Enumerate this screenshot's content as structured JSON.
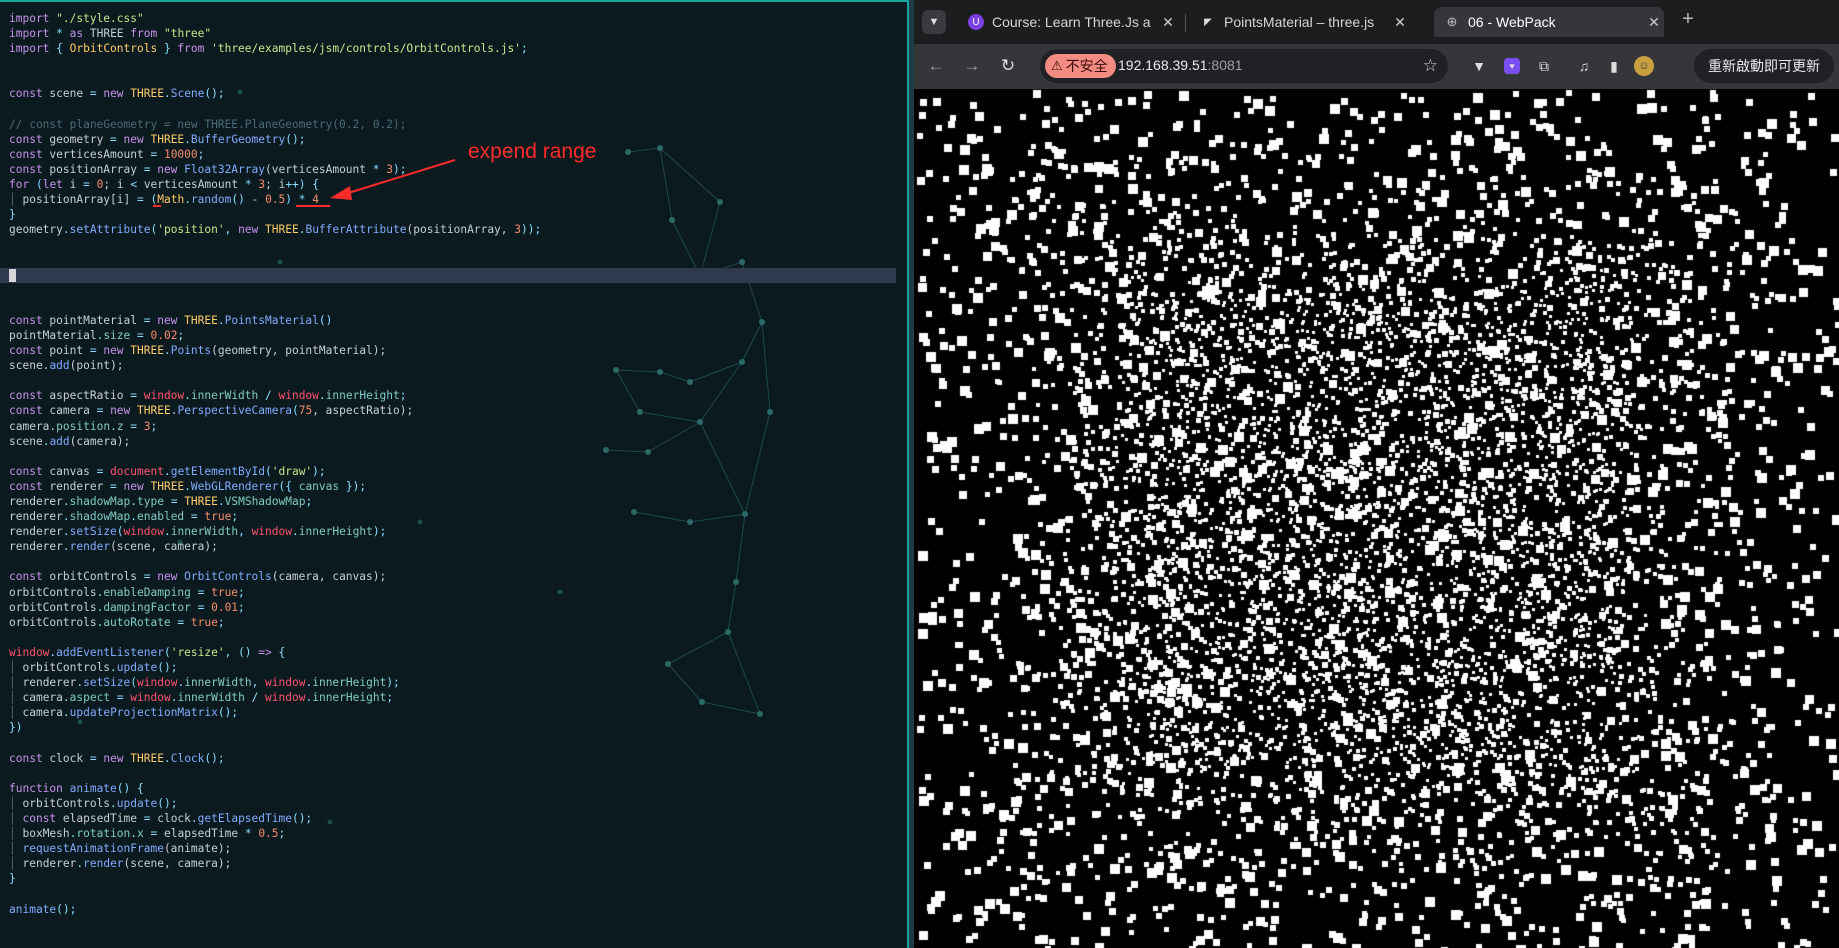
{
  "editor": {
    "annotation": "expend range",
    "lines": [
      [
        [
          "import ",
          "k"
        ],
        [
          "\"./style.css\"",
          "s"
        ]
      ],
      [
        [
          "import ",
          "k"
        ],
        [
          "* ",
          "p"
        ],
        [
          "as ",
          "k"
        ],
        [
          "THREE ",
          ""
        ],
        [
          "from ",
          "k"
        ],
        [
          "\"three\"",
          "s"
        ]
      ],
      [
        [
          "import ",
          "k"
        ],
        [
          "{ ",
          "p"
        ],
        [
          "OrbitControls",
          "t"
        ],
        [
          " } ",
          "p"
        ],
        [
          "from ",
          "k"
        ],
        [
          "'three/examples/jsm/controls/OrbitControls.js'",
          "s"
        ],
        [
          ";",
          "p"
        ]
      ],
      [],
      [],
      [
        [
          "const ",
          "k"
        ],
        [
          "scene ",
          ""
        ],
        [
          "= ",
          "p"
        ],
        [
          "new ",
          "k"
        ],
        [
          "THREE",
          "t"
        ],
        [
          ".",
          "p"
        ],
        [
          "Scene",
          "f"
        ],
        [
          "();",
          "p"
        ]
      ],
      [],
      [
        [
          "// const planeGeometry = new THREE.PlaneGeometry(0.2, 0.2);",
          "c"
        ]
      ],
      [
        [
          "const ",
          "k"
        ],
        [
          "geometry ",
          ""
        ],
        [
          "= ",
          "p"
        ],
        [
          "new ",
          "k"
        ],
        [
          "THREE",
          "t"
        ],
        [
          ".",
          "p"
        ],
        [
          "BufferGeometry",
          "f"
        ],
        [
          "();",
          "p"
        ]
      ],
      [
        [
          "const ",
          "k"
        ],
        [
          "verticesAmount ",
          ""
        ],
        [
          "= ",
          "p"
        ],
        [
          "10000",
          "n"
        ],
        [
          ";",
          "p"
        ]
      ],
      [
        [
          "const ",
          "k"
        ],
        [
          "positionArray ",
          ""
        ],
        [
          "= ",
          "p"
        ],
        [
          "new ",
          "k"
        ],
        [
          "Float32Array",
          "f"
        ],
        [
          "(verticesAmount ",
          ""
        ],
        [
          "* ",
          "p"
        ],
        [
          "3",
          "n"
        ],
        [
          ");",
          "p"
        ]
      ],
      [
        [
          "for ",
          "k"
        ],
        [
          "(",
          "p"
        ],
        [
          "let ",
          "k"
        ],
        [
          "i ",
          ""
        ],
        [
          "= ",
          "p"
        ],
        [
          "0",
          "n"
        ],
        [
          "; i ",
          ""
        ],
        [
          "< ",
          "p"
        ],
        [
          "verticesAmount ",
          ""
        ],
        [
          "* ",
          "p"
        ],
        [
          "3",
          "n"
        ],
        [
          "; i",
          ""
        ],
        [
          "++",
          "p"
        ],
        [
          ") {",
          "p"
        ]
      ],
      [
        [
          "│ ",
          "c"
        ],
        [
          "positionArray[i] ",
          ""
        ],
        [
          "= ",
          "p"
        ],
        [
          "(",
          "p"
        ],
        [
          "Math",
          "t"
        ],
        [
          ".",
          "p"
        ],
        [
          "random",
          "f"
        ],
        [
          "() ",
          "p"
        ],
        [
          "- ",
          "p"
        ],
        [
          "0.5",
          "n"
        ],
        [
          ") ",
          "p"
        ],
        [
          "* ",
          "p"
        ],
        [
          "4",
          "n"
        ]
      ],
      [
        [
          "}",
          "p"
        ]
      ],
      [
        [
          "geometry",
          ""
        ],
        [
          ".",
          "p"
        ],
        [
          "setAttribute",
          "f"
        ],
        [
          "(",
          "p"
        ],
        [
          "'position'",
          "s"
        ],
        [
          ", ",
          "p"
        ],
        [
          "new ",
          "k"
        ],
        [
          "THREE",
          "t"
        ],
        [
          ".",
          "p"
        ],
        [
          "BufferAttribute",
          "f"
        ],
        [
          "(positionArray, ",
          ""
        ],
        [
          "3",
          "n"
        ],
        [
          "));",
          "p"
        ]
      ],
      [],
      [],
      [
        [
          "CURSOR",
          "cursor"
        ]
      ],
      [],
      [],
      [
        [
          "const ",
          "k"
        ],
        [
          "pointMaterial ",
          ""
        ],
        [
          "= ",
          "p"
        ],
        [
          "new ",
          "k"
        ],
        [
          "THREE",
          "t"
        ],
        [
          ".",
          "p"
        ],
        [
          "PointsMaterial",
          "f"
        ],
        [
          "()",
          "p"
        ]
      ],
      [
        [
          "pointMaterial",
          ""
        ],
        [
          ".",
          "p"
        ],
        [
          "size ",
          "pr"
        ],
        [
          "= ",
          "p"
        ],
        [
          "0.02",
          "n"
        ],
        [
          ";",
          "p"
        ]
      ],
      [
        [
          "const ",
          "k"
        ],
        [
          "point ",
          ""
        ],
        [
          "= ",
          "p"
        ],
        [
          "new ",
          "k"
        ],
        [
          "THREE",
          "t"
        ],
        [
          ".",
          "p"
        ],
        [
          "Points",
          "f"
        ],
        [
          "(geometry, pointMaterial);",
          ""
        ]
      ],
      [
        [
          "scene",
          ""
        ],
        [
          ".",
          "p"
        ],
        [
          "add",
          "f"
        ],
        [
          "(point);",
          ""
        ]
      ],
      [],
      [
        [
          "const ",
          "k"
        ],
        [
          "aspectRatio ",
          ""
        ],
        [
          "= ",
          "p"
        ],
        [
          "window",
          "g"
        ],
        [
          ".",
          "p"
        ],
        [
          "innerWidth ",
          "pr"
        ],
        [
          "/ ",
          "p"
        ],
        [
          "window",
          "g"
        ],
        [
          ".",
          "p"
        ],
        [
          "innerHeight",
          "pr"
        ],
        [
          ";",
          "p"
        ]
      ],
      [
        [
          "const ",
          "k"
        ],
        [
          "camera ",
          ""
        ],
        [
          "= ",
          "p"
        ],
        [
          "new ",
          "k"
        ],
        [
          "THREE",
          "t"
        ],
        [
          ".",
          "p"
        ],
        [
          "PerspectiveCamera",
          "f"
        ],
        [
          "(",
          "p"
        ],
        [
          "75",
          "n"
        ],
        [
          ", aspectRatio);",
          ""
        ]
      ],
      [
        [
          "camera",
          ""
        ],
        [
          ".",
          "p"
        ],
        [
          "position",
          "pr"
        ],
        [
          ".",
          "p"
        ],
        [
          "z ",
          "pr"
        ],
        [
          "= ",
          "p"
        ],
        [
          "3",
          "n"
        ],
        [
          ";",
          "p"
        ]
      ],
      [
        [
          "scene",
          ""
        ],
        [
          ".",
          "p"
        ],
        [
          "add",
          "f"
        ],
        [
          "(camera);",
          ""
        ]
      ],
      [],
      [
        [
          "const ",
          "k"
        ],
        [
          "canvas ",
          ""
        ],
        [
          "= ",
          "p"
        ],
        [
          "document",
          "g"
        ],
        [
          ".",
          "p"
        ],
        [
          "getElementById",
          "f"
        ],
        [
          "(",
          "p"
        ],
        [
          "'draw'",
          "s"
        ],
        [
          ");",
          "p"
        ]
      ],
      [
        [
          "const ",
          "k"
        ],
        [
          "renderer ",
          ""
        ],
        [
          "= ",
          "p"
        ],
        [
          "new ",
          "k"
        ],
        [
          "THREE",
          "t"
        ],
        [
          ".",
          "p"
        ],
        [
          "WebGLRenderer",
          "f"
        ],
        [
          "({ ",
          "p"
        ],
        [
          "canvas ",
          "pr"
        ],
        [
          "});",
          "p"
        ]
      ],
      [
        [
          "renderer",
          ""
        ],
        [
          ".",
          "p"
        ],
        [
          "shadowMap",
          "pr"
        ],
        [
          ".",
          "p"
        ],
        [
          "type ",
          "pr"
        ],
        [
          "= ",
          "p"
        ],
        [
          "THREE",
          "t"
        ],
        [
          ".",
          "p"
        ],
        [
          "VSMShadowMap",
          "pr"
        ],
        [
          ";",
          "p"
        ]
      ],
      [
        [
          "renderer",
          ""
        ],
        [
          ".",
          "p"
        ],
        [
          "shadowMap",
          "pr"
        ],
        [
          ".",
          "p"
        ],
        [
          "enabled ",
          "pr"
        ],
        [
          "= ",
          "p"
        ],
        [
          "true",
          "n"
        ],
        [
          ";",
          "p"
        ]
      ],
      [
        [
          "renderer",
          ""
        ],
        [
          ".",
          "p"
        ],
        [
          "setSize",
          "f"
        ],
        [
          "(",
          "p"
        ],
        [
          "window",
          "g"
        ],
        [
          ".",
          "p"
        ],
        [
          "innerWidth",
          "pr"
        ],
        [
          ", ",
          "p"
        ],
        [
          "window",
          "g"
        ],
        [
          ".",
          "p"
        ],
        [
          "innerHeight",
          "pr"
        ],
        [
          ");",
          "p"
        ]
      ],
      [
        [
          "renderer",
          ""
        ],
        [
          ".",
          "p"
        ],
        [
          "render",
          "f"
        ],
        [
          "(scene, camera);",
          ""
        ]
      ],
      [],
      [
        [
          "const ",
          "k"
        ],
        [
          "orbitControls ",
          ""
        ],
        [
          "= ",
          "p"
        ],
        [
          "new ",
          "k"
        ],
        [
          "OrbitControls",
          "f"
        ],
        [
          "(camera, canvas);",
          ""
        ]
      ],
      [
        [
          "orbitControls",
          ""
        ],
        [
          ".",
          "p"
        ],
        [
          "enableDamping ",
          "pr"
        ],
        [
          "= ",
          "p"
        ],
        [
          "true",
          "n"
        ],
        [
          ";",
          "p"
        ]
      ],
      [
        [
          "orbitControls",
          ""
        ],
        [
          ".",
          "p"
        ],
        [
          "dampingFactor ",
          "pr"
        ],
        [
          "= ",
          "p"
        ],
        [
          "0.01",
          "n"
        ],
        [
          ";",
          "p"
        ]
      ],
      [
        [
          "orbitControls",
          ""
        ],
        [
          ".",
          "p"
        ],
        [
          "autoRotate ",
          "pr"
        ],
        [
          "= ",
          "p"
        ],
        [
          "true",
          "n"
        ],
        [
          ";",
          "p"
        ]
      ],
      [],
      [
        [
          "window",
          "g"
        ],
        [
          ".",
          "p"
        ],
        [
          "addEventListener",
          "f"
        ],
        [
          "(",
          "p"
        ],
        [
          "'resize'",
          "s"
        ],
        [
          ", () ",
          "p"
        ],
        [
          "=> ",
          "k"
        ],
        [
          "{",
          "p"
        ]
      ],
      [
        [
          "│ ",
          "c"
        ],
        [
          "orbitControls",
          ""
        ],
        [
          ".",
          "p"
        ],
        [
          "update",
          "f"
        ],
        [
          "();",
          "p"
        ]
      ],
      [
        [
          "│ ",
          "c"
        ],
        [
          "renderer",
          ""
        ],
        [
          ".",
          "p"
        ],
        [
          "setSize",
          "f"
        ],
        [
          "(",
          "p"
        ],
        [
          "window",
          "g"
        ],
        [
          ".",
          "p"
        ],
        [
          "innerWidth",
          "pr"
        ],
        [
          ", ",
          "p"
        ],
        [
          "window",
          "g"
        ],
        [
          ".",
          "p"
        ],
        [
          "innerHeight",
          "pr"
        ],
        [
          ");",
          "p"
        ]
      ],
      [
        [
          "│ ",
          "c"
        ],
        [
          "camera",
          ""
        ],
        [
          ".",
          "p"
        ],
        [
          "aspect ",
          "pr"
        ],
        [
          "= ",
          "p"
        ],
        [
          "window",
          "g"
        ],
        [
          ".",
          "p"
        ],
        [
          "innerWidth ",
          "pr"
        ],
        [
          "/ ",
          "p"
        ],
        [
          "window",
          "g"
        ],
        [
          ".",
          "p"
        ],
        [
          "innerHeight",
          "pr"
        ],
        [
          ";",
          "p"
        ]
      ],
      [
        [
          "│ ",
          "c"
        ],
        [
          "camera",
          ""
        ],
        [
          ".",
          "p"
        ],
        [
          "updateProjectionMatrix",
          "f"
        ],
        [
          "();",
          "p"
        ]
      ],
      [
        [
          "})",
          "p"
        ]
      ],
      [],
      [
        [
          "const ",
          "k"
        ],
        [
          "clock ",
          ""
        ],
        [
          "= ",
          "p"
        ],
        [
          "new ",
          "k"
        ],
        [
          "THREE",
          "t"
        ],
        [
          ".",
          "p"
        ],
        [
          "Clock",
          "f"
        ],
        [
          "();",
          "p"
        ]
      ],
      [],
      [
        [
          "function ",
          "k"
        ],
        [
          "animate",
          "f"
        ],
        [
          "() {",
          "p"
        ]
      ],
      [
        [
          "│ ",
          "c"
        ],
        [
          "orbitControls",
          ""
        ],
        [
          ".",
          "p"
        ],
        [
          "update",
          "f"
        ],
        [
          "();",
          "p"
        ]
      ],
      [
        [
          "│ ",
          "c"
        ],
        [
          "const ",
          "k"
        ],
        [
          "elapsedTime ",
          ""
        ],
        [
          "= ",
          "p"
        ],
        [
          "clock",
          ""
        ],
        [
          ".",
          "p"
        ],
        [
          "getElapsedTime",
          "f"
        ],
        [
          "();",
          "p"
        ]
      ],
      [
        [
          "│ ",
          "c"
        ],
        [
          "boxMesh",
          ""
        ],
        [
          ".",
          "p"
        ],
        [
          "rotation",
          "pr"
        ],
        [
          ".",
          "p"
        ],
        [
          "x ",
          "pr"
        ],
        [
          "= ",
          "p"
        ],
        [
          "elapsedTime ",
          ""
        ],
        [
          "* ",
          "p"
        ],
        [
          "0.5",
          "n"
        ],
        [
          ";",
          "p"
        ]
      ],
      [
        [
          "│ ",
          "c"
        ],
        [
          "requestAnimationFrame",
          "f"
        ],
        [
          "(animate);",
          ""
        ]
      ],
      [
        [
          "│ ",
          "c"
        ],
        [
          "renderer",
          ""
        ],
        [
          ".",
          "p"
        ],
        [
          "render",
          "f"
        ],
        [
          "(scene, camera);",
          ""
        ]
      ],
      [
        [
          "}",
          "p"
        ]
      ],
      [],
      [
        [
          "animate",
          "f"
        ],
        [
          "();",
          "p"
        ]
      ]
    ]
  },
  "browser": {
    "tabs": [
      {
        "title": "Course: Learn Three.Js a",
        "icon": "course-favicon-icon"
      },
      {
        "title": "PointsMaterial – three.js",
        "icon": "threejs-favicon-icon"
      },
      {
        "title": "06 - WebPack",
        "icon": "globe-icon"
      }
    ],
    "new_tab_label": "+",
    "security_label": "不安全",
    "url_host": "192.168.39.51",
    "url_port": ":8081",
    "restart_label": "重新啟動即可更新",
    "accent": "#13a39a"
  }
}
